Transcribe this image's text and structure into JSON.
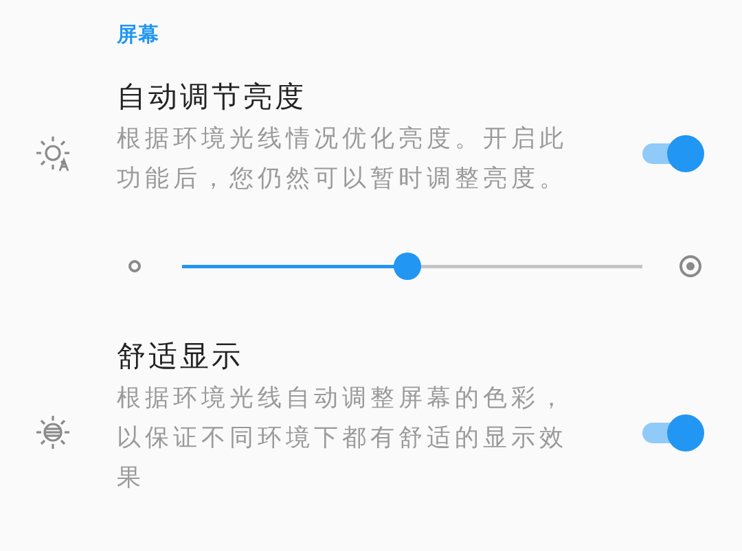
{
  "section_header": "屏幕",
  "items": [
    {
      "kind": "toggle",
      "title": "自动调节亮度",
      "description": "根据环境光线情况优化亮度。开启此功能后，您仍然可以暂时调整亮度。",
      "on": true
    },
    {
      "kind": "slider",
      "level": 0.49
    },
    {
      "kind": "toggle",
      "title": "舒适显示",
      "description": "根据环境光线自动调整屏幕的色彩，以保证不同环境下都有舒适的显示效果",
      "on": true
    }
  ]
}
